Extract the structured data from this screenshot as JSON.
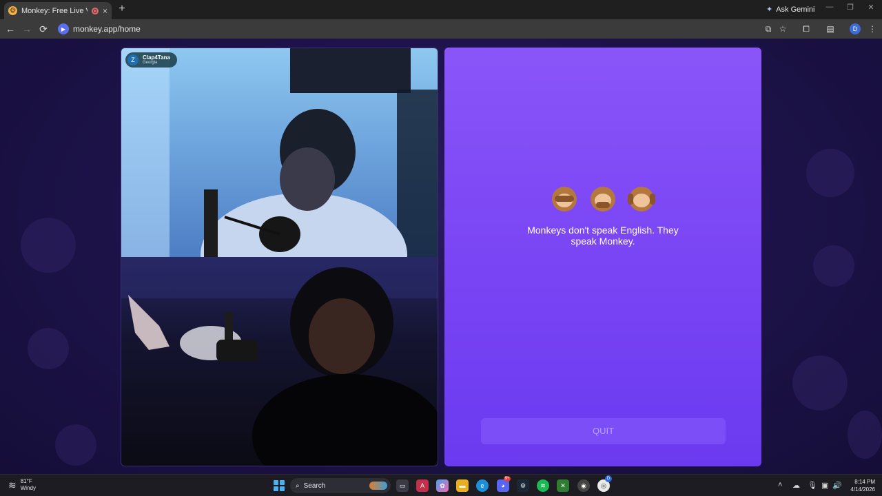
{
  "browser": {
    "tab_title": "Monkey: Free Live Video Chat",
    "new_tab_glyph": "+",
    "close_glyph": "×",
    "ask_gemini_label": "Ask Gemini",
    "url": "monkey.app/home",
    "profile_initial": "D",
    "window_controls": [
      "—",
      "❐",
      "✕"
    ],
    "nav": {
      "back": "←",
      "forward": "→",
      "reload": "⟳"
    }
  },
  "remote_peer": {
    "avatar_letter": "Z",
    "name": "Clap4Tana",
    "location": "Georgia"
  },
  "chat": {
    "emoji_icons": [
      "see-no-evil-monkey-icon",
      "speak-no-evil-monkey-icon",
      "hear-no-evil-monkey-icon"
    ],
    "message": "Monkeys don't speak English. They speak Monkey.",
    "quit_label": "QUIT"
  },
  "taskbar": {
    "weather_temp": "81°F",
    "weather_desc": "Windy",
    "search_label": "Search",
    "discord_badge": "9+",
    "chrome_badge": "D",
    "time": "8:14 PM",
    "date": "4/14/2026"
  },
  "colors": {
    "chat_gradient_top": "#8a55f8",
    "chat_gradient_bottom": "#6b3af0",
    "page_background": "#1c1248",
    "badge_background": "#193c46"
  }
}
